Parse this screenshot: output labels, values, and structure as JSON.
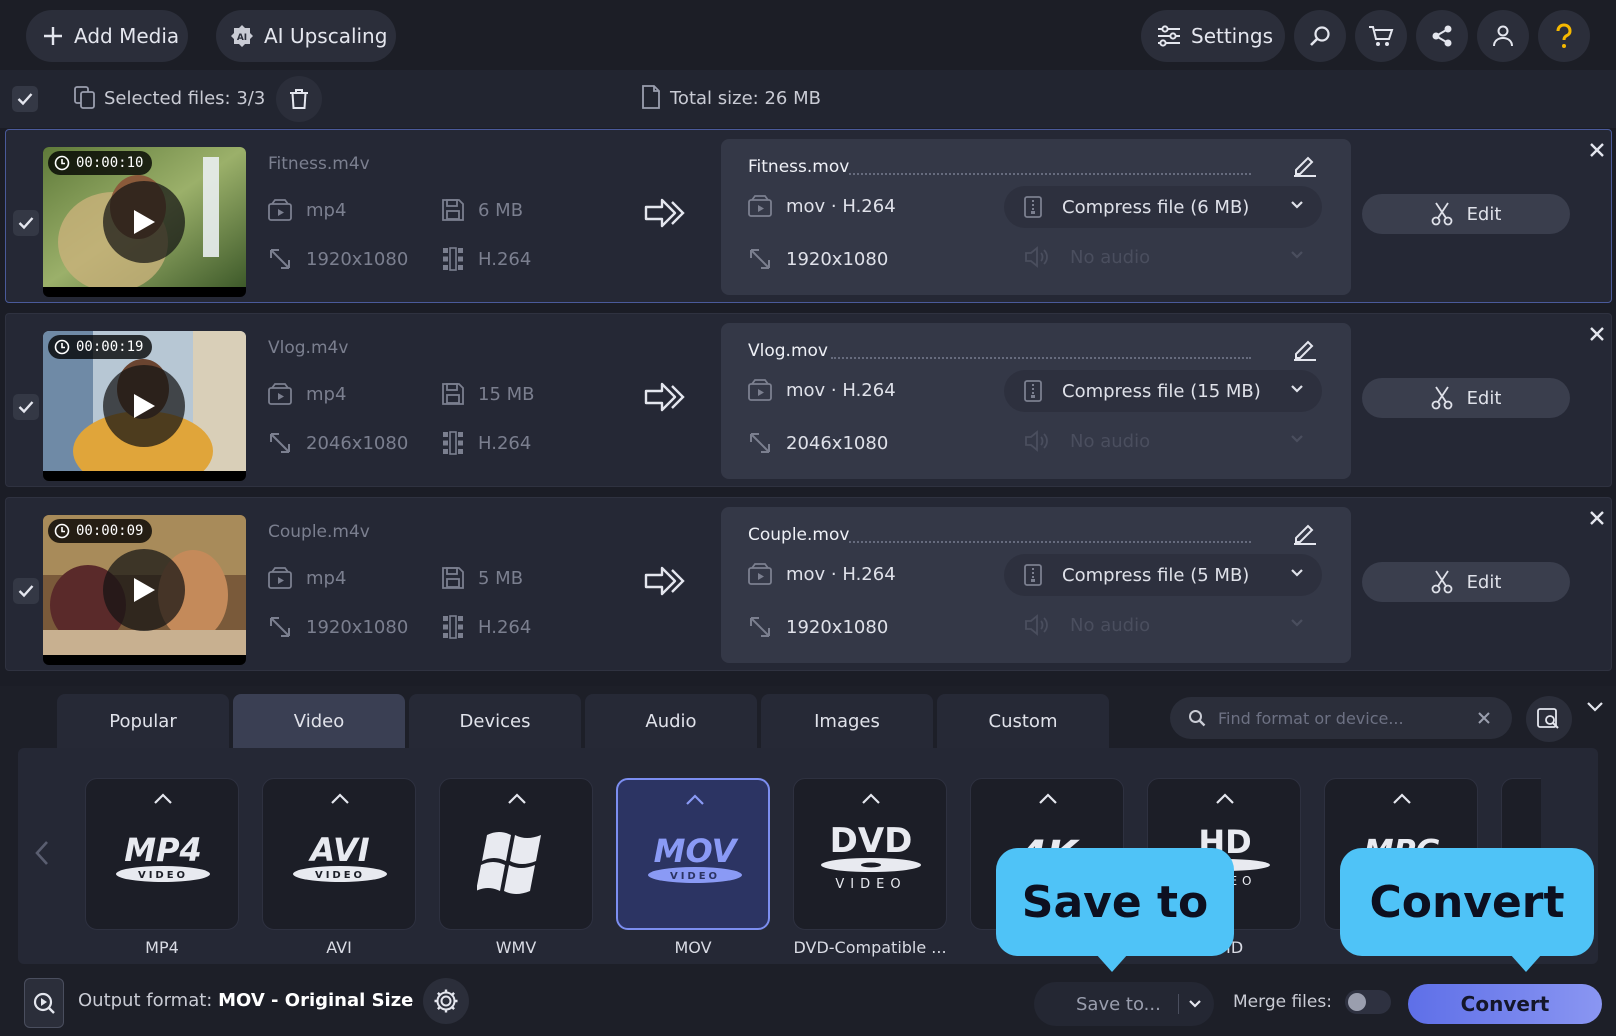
{
  "toolbar": {
    "add_media": "Add Media",
    "ai_upscaling": "AI Upscaling",
    "settings": "Settings"
  },
  "selection": {
    "selected_label": "Selected files:",
    "selected_value": "3/3",
    "total_label": "Total size:",
    "total_value": "26 MB"
  },
  "files": [
    {
      "duration": "00:00:10",
      "name": "Fitness.m4v",
      "container": "mp4",
      "size": "6 MB",
      "resolution": "1920x1080",
      "codec": "H.264",
      "out_name": "Fitness.mov",
      "out_format": "mov · H.264",
      "out_resolution": "1920x1080",
      "compress": "Compress file (6 MB)",
      "audio": "No audio",
      "edit": "Edit"
    },
    {
      "duration": "00:00:19",
      "name": "Vlog.m4v",
      "container": "mp4",
      "size": "15 MB",
      "resolution": "2046x1080",
      "codec": "H.264",
      "out_name": "Vlog.mov",
      "out_format": "mov · H.264",
      "out_resolution": "2046x1080",
      "compress": "Compress file (15 MB)",
      "audio": "No audio",
      "edit": "Edit"
    },
    {
      "duration": "00:00:09",
      "name": "Couple.m4v",
      "container": "mp4",
      "size": "5 MB",
      "resolution": "1920x1080",
      "codec": "H.264",
      "out_name": "Couple.mov",
      "out_format": "mov · H.264",
      "out_resolution": "1920x1080",
      "compress": "Compress file (5 MB)",
      "audio": "No audio",
      "edit": "Edit"
    }
  ],
  "tabs": [
    "Popular",
    "Video",
    "Devices",
    "Audio",
    "Images",
    "Custom"
  ],
  "selected_tab": "Video",
  "search": {
    "placeholder": "Find format or device..."
  },
  "formats": [
    {
      "label": "MP4",
      "logo": "MP4",
      "sub": "VIDEO"
    },
    {
      "label": "AVI",
      "logo": "AVI",
      "sub": "VIDEO"
    },
    {
      "label": "WMV",
      "logo": "windows-logo"
    },
    {
      "label": "MOV",
      "logo": "MOV",
      "sub": "VIDEO"
    },
    {
      "label": "DVD-Compatible ...",
      "logo": "DVD",
      "sub": "VIDEO"
    },
    {
      "label": "4K",
      "logo": "4K"
    },
    {
      "label": "Full HD",
      "label_visible": "ll HD",
      "logo": "HD",
      "sub": "VIDEO"
    },
    {
      "label": "MPG",
      "logo": "MPG"
    }
  ],
  "selected_format": "MOV",
  "output": {
    "label": "Output format:",
    "value": "MOV - Original Size"
  },
  "save_to": "Save to...",
  "merge_files": "Merge files:",
  "merge_enabled": false,
  "convert": "Convert",
  "callouts": {
    "save_to": "Save to",
    "convert": "Convert"
  },
  "colors": {
    "accent": "#6f7ff0",
    "callout": "#4fc3f7",
    "background": "#1b1d26",
    "help": "#f5b800"
  }
}
